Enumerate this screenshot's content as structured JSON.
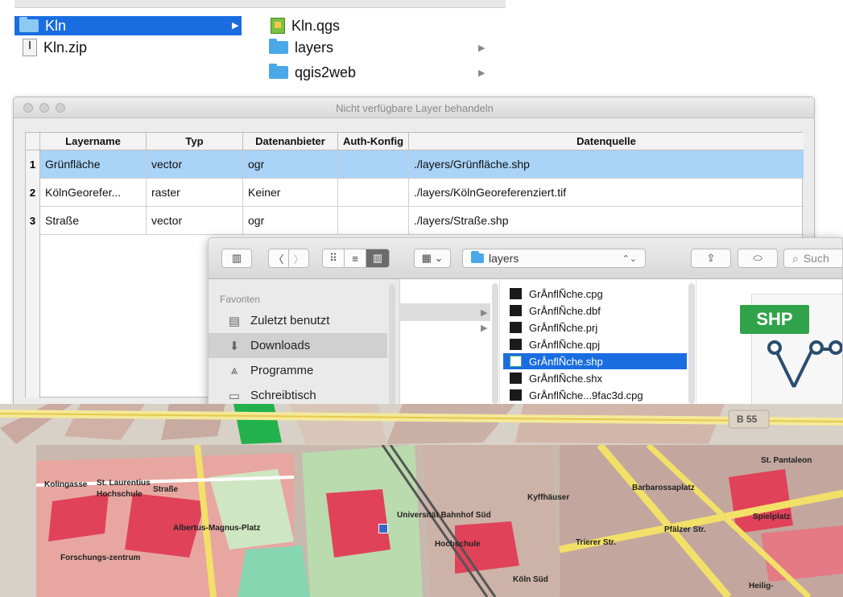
{
  "finder_top": {
    "col1": [
      {
        "label": "Kln",
        "type": "folder",
        "selected": true
      },
      {
        "label": "Kln.zip",
        "type": "zip",
        "selected": false
      }
    ],
    "col2": [
      {
        "label": "Kln.qgs",
        "type": "qgs"
      },
      {
        "label": "layers",
        "type": "folder"
      },
      {
        "label": "qgis2web",
        "type": "folder"
      }
    ]
  },
  "qgis_dialog": {
    "title": "Nicht verfügbare Layer behandeln",
    "columns": [
      "Layername",
      "Typ",
      "Datenanbieter",
      "Auth-Konfig",
      "Datenquelle"
    ],
    "rows": [
      {
        "num": "1",
        "name": "Grünfläche",
        "type": "vector",
        "provider": "ogr",
        "auth": "",
        "source": "./layers/Grünfläche.shp",
        "selected": true
      },
      {
        "num": "2",
        "name": "KölnGeorefer...",
        "type": "raster",
        "provider": "Keiner",
        "auth": "",
        "source": "./layers/KölnGeoreferenziert.tif",
        "selected": false
      },
      {
        "num": "3",
        "name": "Straße",
        "type": "vector",
        "provider": "ogr",
        "auth": "",
        "source": "./layers/Straße.shp",
        "selected": false
      }
    ]
  },
  "finder_window": {
    "path_label": "layers",
    "search_placeholder": "Such",
    "sidebar_heading": "Favoriten",
    "sidebar": [
      {
        "label": "Zuletzt benutzt",
        "icon": "clock-icon",
        "selected": false
      },
      {
        "label": "Downloads",
        "icon": "download-icon",
        "selected": true
      },
      {
        "label": "Programme",
        "icon": "apps-icon",
        "selected": false
      },
      {
        "label": "Schreibtisch",
        "icon": "desktop-icon",
        "selected": false
      }
    ],
    "files": [
      {
        "label": "GrÅnflÑche.cpg",
        "selected": false
      },
      {
        "label": "GrÅnflÑche.dbf",
        "selected": false
      },
      {
        "label": "GrÅnflÑche.prj",
        "selected": false
      },
      {
        "label": "GrÅnflÑche.qpj",
        "selected": false
      },
      {
        "label": "GrÅnflÑche.shp",
        "selected": true
      },
      {
        "label": "GrÅnflÑche.shx",
        "selected": false
      },
      {
        "label": "GrÅnflÑche...9fac3d.cpg",
        "selected": false
      }
    ],
    "preview_badge": "SHP"
  },
  "maps": {
    "map1_labels": [
      "B 55"
    ],
    "map2_labels": [
      "Kolingasse",
      "St. Laurentius",
      "Hochschule",
      "Straße",
      "Albertus-Magnus-Platz",
      "Universität Bahnhof Süd",
      "Hochschule",
      "Kyffhäuser",
      "Barbarossaplatz",
      "St. Pantaleon",
      "Spielplatz",
      "Trierer Str.",
      "Pfälzer Str.",
      "Köln Süd",
      "Forschungs-zentrum",
      "Heilig-"
    ]
  },
  "colors": {
    "selection_blue": "#1a6de0",
    "row_selection": "#a9d3f7",
    "folder_blue": "#4aa8e8",
    "shp_green": "#30a34a"
  }
}
